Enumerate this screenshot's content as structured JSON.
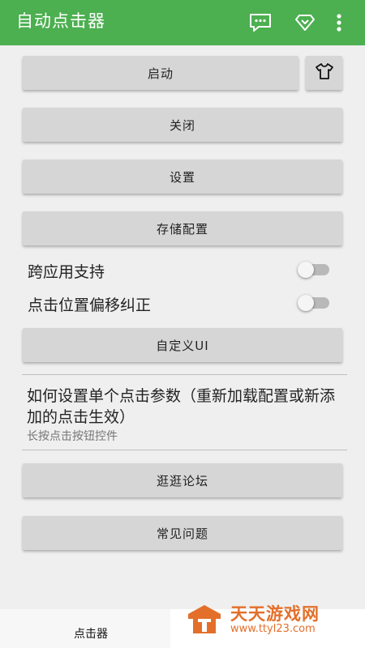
{
  "appbar": {
    "title": "自动点击器",
    "icons": [
      "message-icon",
      "diamond-icon",
      "more-vert-icon"
    ],
    "color": "#4caf50"
  },
  "buttons": {
    "start": "启动",
    "close": "关闭",
    "settings": "设置",
    "save_config": "存储配置",
    "custom_ui": "自定义UI",
    "forum": "逛逛论坛",
    "faq": "常见问题"
  },
  "toggles": {
    "cross_app": {
      "label": "跨应用支持",
      "on": false
    },
    "offset_fix": {
      "label": "点击位置偏移纠正",
      "on": false
    }
  },
  "help": {
    "title": "如何设置单个点击参数（重新加载配置或新添加的点击生效）",
    "subtitle": "长按点击按钮控件"
  },
  "bottom_tab": {
    "label": "点击器"
  },
  "watermark": {
    "name": "天天游戏网",
    "url": "www.ttyl23.com"
  }
}
